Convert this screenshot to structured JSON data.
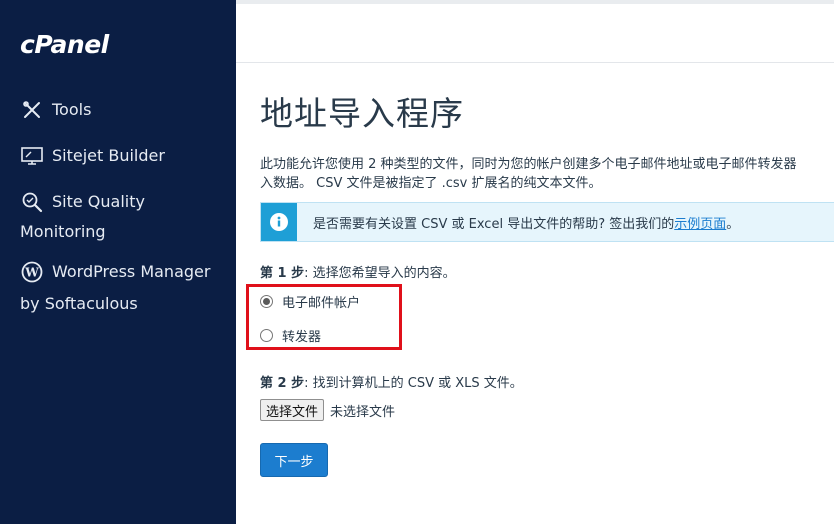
{
  "sidebar": {
    "logo": "cPanel",
    "items": [
      {
        "label": "Tools",
        "icon": "tools-icon"
      },
      {
        "label": "Sitejet Builder",
        "icon": "sitejet-builder-icon"
      },
      {
        "label": "Site Quality",
        "label2": "Monitoring",
        "icon": "site-quality-icon"
      },
      {
        "label": "WordPress Manager",
        "label2": "by Softaculous",
        "icon": "wordpress-icon"
      }
    ]
  },
  "main": {
    "title": "地址导入程序",
    "description_line1": "此功能允许您使用 2 种类型的文件，同时为您的帐户创建多个电子邮件地址或电子邮件转发器",
    "description_line2": "入数据。 CSV 文件是被指定了 .csv 扩展名的纯文本文件。",
    "info": {
      "text": "是否需要有关设置 CSV 或 Excel 导出文件的帮助? 签出我们的",
      "link": "示例页面",
      "suffix": "。",
      "icon": "info-icon"
    },
    "step1": {
      "prefix": "第 1 步",
      "text": ": 选择您希望导入的内容。",
      "options": [
        {
          "label": "电子邮件帐户",
          "checked": true
        },
        {
          "label": "转发器",
          "checked": false
        }
      ]
    },
    "step2": {
      "prefix": "第 2 步",
      "text": ": 找到计算机上的 CSV 或 XLS 文件。"
    },
    "file": {
      "button": "选择文件",
      "status": "未选择文件"
    },
    "next_button": "下一步"
  },
  "colors": {
    "sidebar_bg": "#0b1e44",
    "primary_button": "#1c7dcf",
    "info_bg": "#e6f5fc",
    "highlight_red": "#e0101a"
  }
}
